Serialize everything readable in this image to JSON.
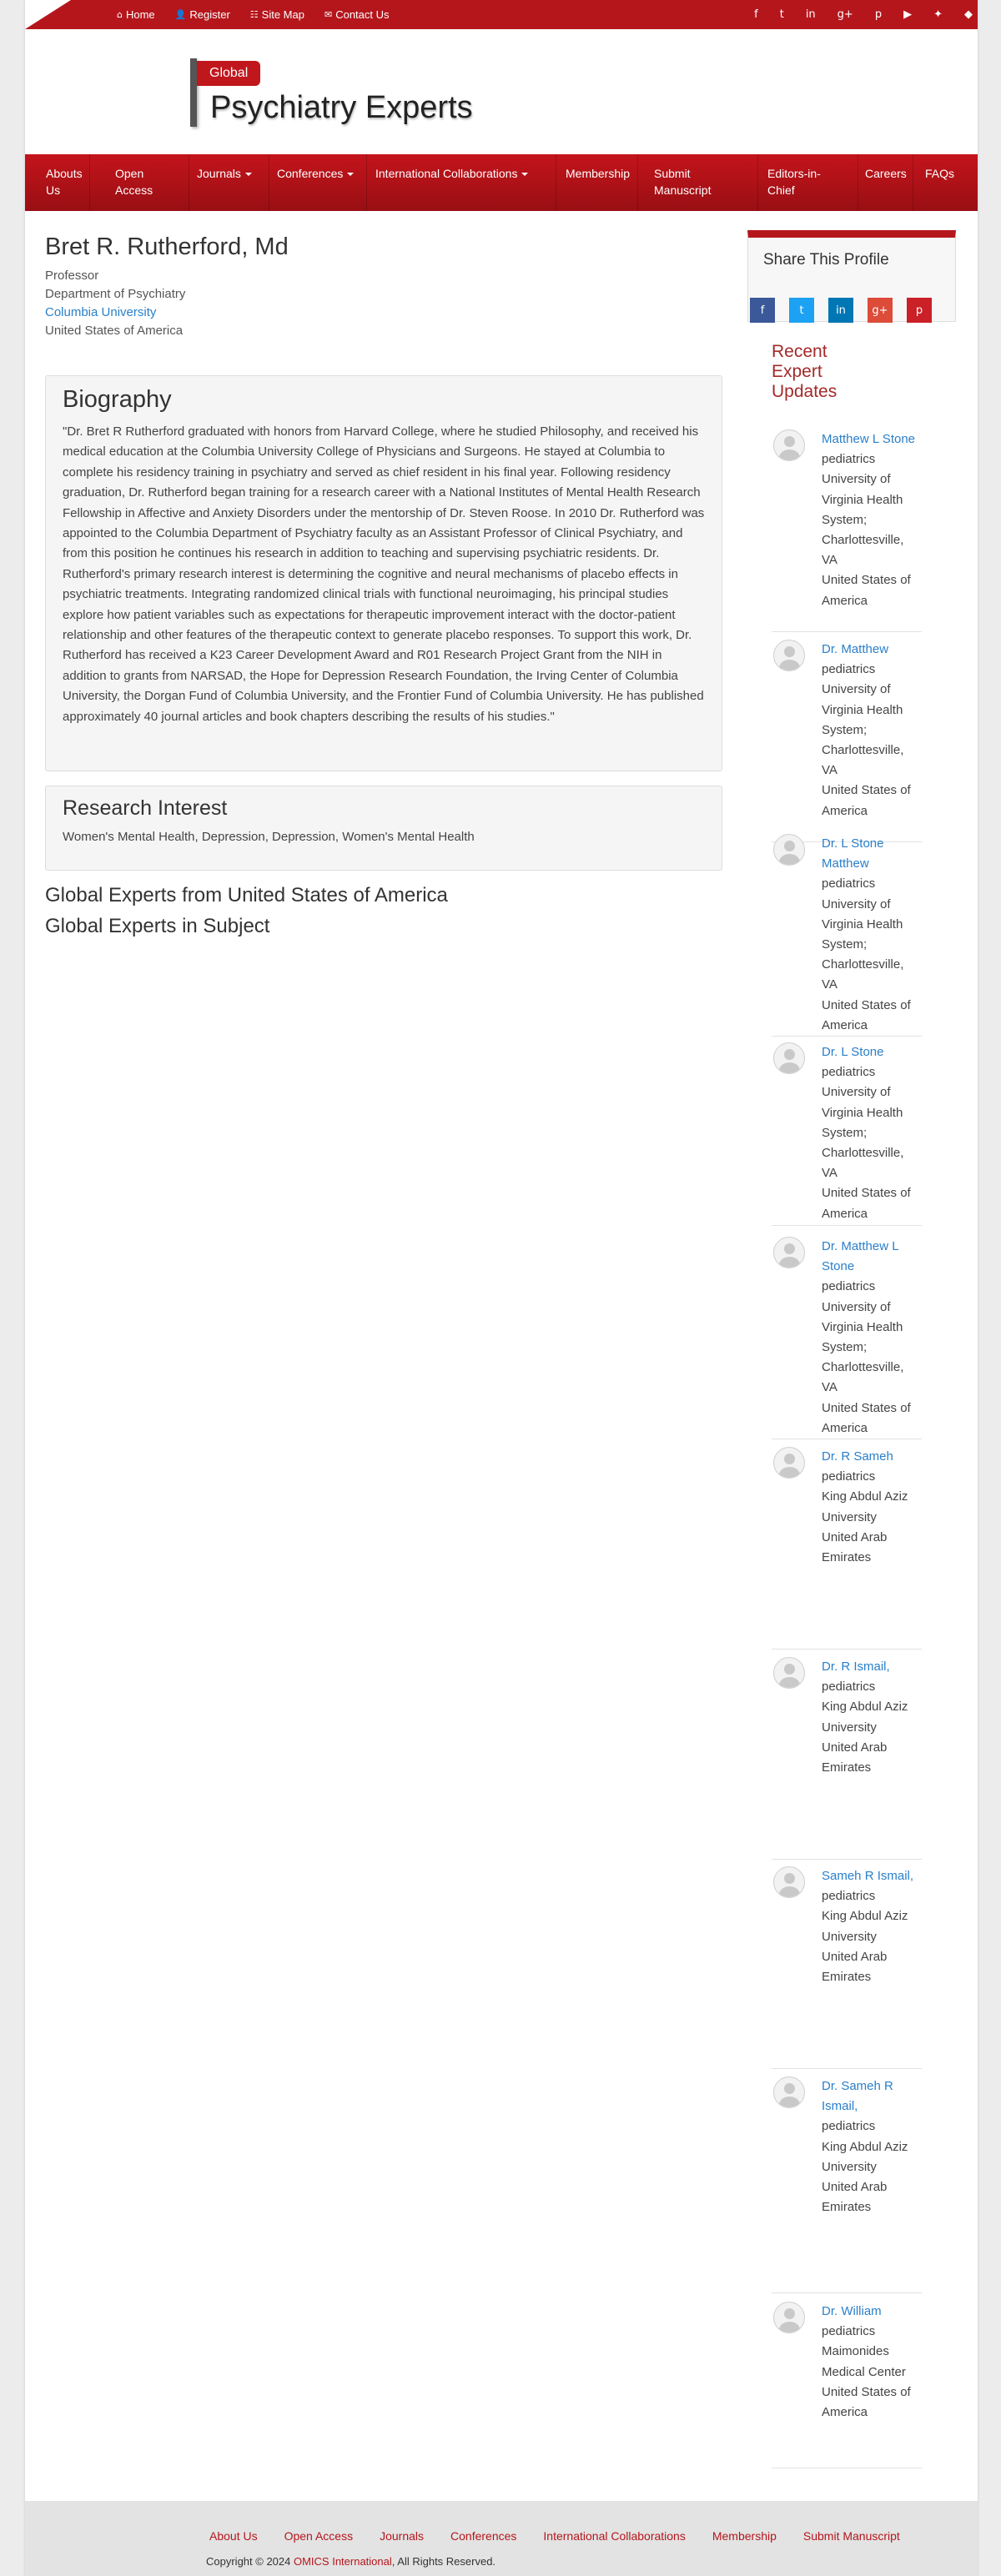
{
  "top_links": [
    {
      "icon": "home-icon",
      "glyph": "⌂",
      "label": "Home"
    },
    {
      "icon": "user-icon",
      "glyph": "👤",
      "label": "Register"
    },
    {
      "icon": "sitemap-icon",
      "glyph": "☷",
      "label": "Site Map"
    },
    {
      "icon": "envelope-icon",
      "glyph": "✉",
      "label": "Contact Us"
    }
  ],
  "social_top": [
    "f",
    "t",
    "in",
    "g+",
    "p",
    "▶",
    "✦",
    "◆"
  ],
  "brand": {
    "badge": "Global",
    "title": "Psychiatry Experts"
  },
  "nav": {
    "about": "Abouts Us",
    "open_access": "Open Access",
    "journals": "Journals",
    "conferences": "Conferences",
    "collaborations": "International Collaborations",
    "membership": "Membership",
    "submit": "Submit Manuscript",
    "editors": "Editors-in-Chief",
    "careers": "Careers",
    "faqs": "FAQs"
  },
  "profile": {
    "name": "Bret R. Rutherford, Md",
    "title": "Professor",
    "department": "Department of Psychiatry",
    "university": "Columbia University",
    "country": "United States of America"
  },
  "biography": {
    "heading": "Biography",
    "text": "\"Dr. Bret R Rutherford graduated with honors from Harvard College, where he studied Philosophy, and received his medical education at the Columbia University College of Physicians and Surgeons. He stayed at Columbia to complete his residency training in psychiatry and served as chief resident in his final year. Following residency graduation, Dr. Rutherford began training for a research career with a National Institutes of Mental Health Research Fellowship in Affective and Anxiety Disorders under the mentorship of Dr. Steven Roose. In 2010 Dr. Rutherford was appointed to the Columbia Department of Psychiatry faculty as an Assistant Professor of Clinical Psychiatry, and from this position he continues his research in addition to teaching and supervising psychiatric residents. Dr. Rutherford's primary research interest is determining the cognitive and neural mechanisms of placebo effects in psychiatric treatments. Integrating randomized clinical trials with functional neuroimaging, his principal studies explore how patient variables such as expectations for therapeutic improvement interact with the doctor-patient relationship and other features of the therapeutic context to generate placebo responses. To support this work, Dr. Rutherford has received a K23 Career Development Award and R01 Research Project Grant from the NIH in addition to grants from NARSAD, the Hope for Depression Research Foundation, the Irving Center of Columbia University, the Dorgan Fund of Columbia University, and the Frontier Fund of Columbia University. He has published approximately 40 journal articles and book chapters describing the results of his studies.\""
  },
  "research": {
    "heading": "Research Interest",
    "text": "Women's Mental Health, Depression, Depression, Women's Mental Health"
  },
  "global_links": {
    "country": "Global Experts from United States of America",
    "subject": "Global Experts in Subject"
  },
  "share": {
    "title": "Share This Profile",
    "icons": [
      {
        "name": "facebook-share-icon",
        "glyph": "f",
        "color": "#3b5998"
      },
      {
        "name": "twitter-share-icon",
        "glyph": "t",
        "color": "#1da1f2"
      },
      {
        "name": "linkedin-share-icon",
        "glyph": "in",
        "color": "#0077b5"
      },
      {
        "name": "googleplus-share-icon",
        "glyph": "g+",
        "color": "#dd4b39"
      },
      {
        "name": "pinterest-share-icon",
        "glyph": "p",
        "color": "#cb2027"
      }
    ]
  },
  "recent": {
    "title": "Recent Expert Updates",
    "experts": [
      {
        "name": "Matthew L Stone",
        "lines": [
          "pediatrics",
          "University of Virginia Health System; Charlottesville, VA",
          "United States of America"
        ]
      },
      {
        "name": "Dr. Matthew",
        "lines": [
          "pediatrics",
          "University of Virginia Health System; Charlottesville, VA",
          "United States of America"
        ]
      },
      {
        "name": "Dr. L Stone Matthew",
        "lines": [
          "pediatrics",
          "University of Virginia Health System; Charlottesville, VA",
          "United States of America"
        ]
      },
      {
        "name": "Dr. L Stone",
        "lines": [
          "pediatrics",
          "University of Virginia Health System; Charlottesville, VA",
          "United States of America"
        ]
      },
      {
        "name": "Dr. Matthew L Stone",
        "lines": [
          "pediatrics",
          "University of Virginia Health System; Charlottesville, VA",
          "United States of America"
        ]
      },
      {
        "name": "Dr. R Sameh",
        "lines": [
          "pediatrics",
          "King Abdul Aziz University",
          "United Arab Emirates"
        ]
      },
      {
        "name": "Dr. R Ismail,",
        "lines": [
          "pediatrics",
          "King Abdul Aziz University",
          "United Arab Emirates"
        ]
      },
      {
        "name": "Sameh R Ismail,",
        "lines": [
          "pediatrics",
          "King Abdul Aziz University",
          "United Arab Emirates"
        ]
      },
      {
        "name": "Dr. Sameh R Ismail,",
        "lines": [
          "pediatrics",
          "King Abdul Aziz University",
          "United Arab Emirates"
        ]
      },
      {
        "name": "Dr. William",
        "lines": [
          "pediatrics",
          "Maimonides Medical Center",
          "United States of America"
        ]
      }
    ]
  },
  "footer": {
    "links": [
      "About Us",
      "Open Access",
      "Journals",
      "Conferences",
      "International Collaborations",
      "Membership",
      "Submit Manuscript"
    ],
    "copyright_prefix": "Copyright © 2024 ",
    "copyright_org": "OMICS International",
    "copyright_suffix": ", All Rights Reserved."
  },
  "colors": {
    "brand_red": "#b5161c",
    "link_blue": "#2a7fc9",
    "recent_title": "#a32a2a"
  }
}
